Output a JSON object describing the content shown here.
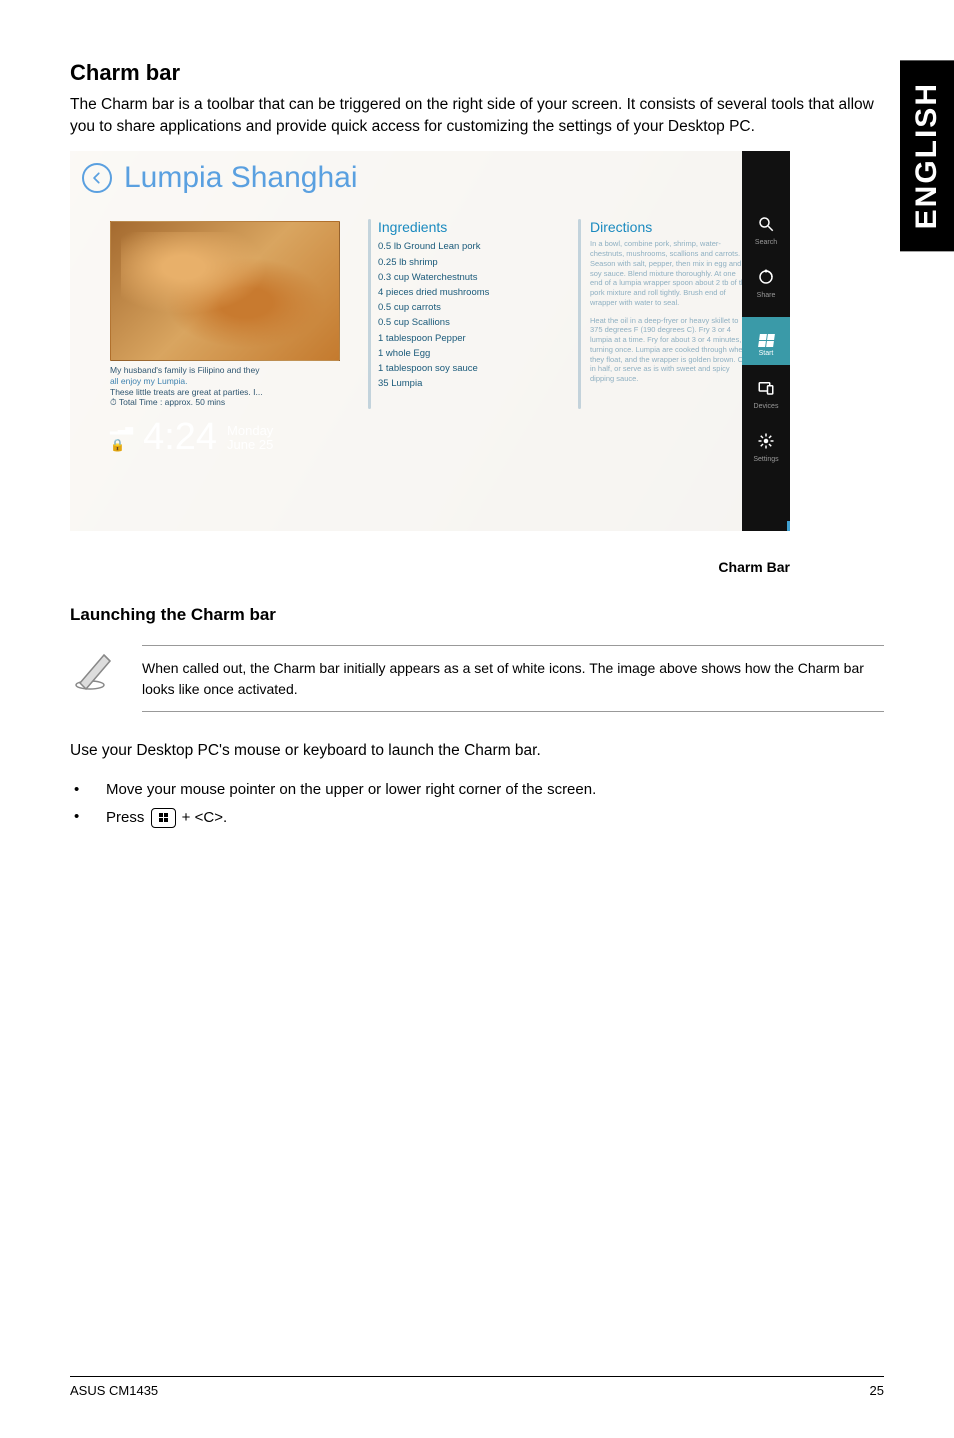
{
  "side_tab": "ENGLISH",
  "section_title": "Charm bar",
  "intro_text": "The Charm bar is a toolbar that can be triggered on the right side of your screen. It consists of several tools that allow you to share applications and provide quick access for customizing the settings of your Desktop PC.",
  "screenshot": {
    "app_title": "Lumpia Shanghai",
    "caption": {
      "line1": "My husband's family is Filipino and they",
      "line2": "all enjoy my Lumpia.",
      "line3": "These little treats are great at parties. I...",
      "line4": "Total Time : approx. 50 mins"
    },
    "time": "4:24",
    "day": "Monday",
    "date": "June 25",
    "ingredients_title": "Ingredients",
    "ingredients": [
      "0.5 lb Ground Lean pork",
      "0.25 lb shrimp",
      "0.3 cup Waterchestnuts",
      "4 pieces dried mushrooms",
      "0.5 cup carrots",
      "0.5 cup Scallions",
      "1 tablespoon Pepper",
      "1 whole Egg",
      "1 tablespoon soy sauce",
      "35 Lumpia"
    ],
    "directions_title": "Directions",
    "directions_p1": "In a bowl, combine pork, shrimp, water-chestnuts, mushrooms, scallions and carrots. Season with salt, pepper, then mix in egg and soy sauce. Blend mixture thoroughly. At one end of a lumpia wrapper spoon about 2 tb of the pork mixture and roll tightly. Brush end of wrapper with water to seal.",
    "directions_p2": "Heat the oil in a deep-fryer or heavy skillet to 375 degrees F (190 degrees C). Fry 3 or 4 lumpia at a time. Fry for about 3 or 4 minutes, turning once. Lumpia are cooked through when they float, and the wrapper is golden brown. Cut in half, or serve as is with sweet and spicy dipping sauce.",
    "charms": [
      {
        "label": "Search"
      },
      {
        "label": "Share"
      },
      {
        "label": "Start"
      },
      {
        "label": "Devices"
      },
      {
        "label": "Settings"
      }
    ]
  },
  "charm_bar_label": "Charm Bar",
  "sub_title": "Launching the Charm bar",
  "note_text": "When called out, the Charm bar initially appears as a set of white icons. The image above shows how the Charm bar looks like once activated.",
  "use_text": "Use your Desktop PC's mouse or keyboard to launch the Charm bar.",
  "bullet1": "Move your mouse pointer on the upper or lower right corner of the screen.",
  "bullet2_prefix": "Press ",
  "bullet2_suffix": " + <C>.",
  "footer_left": "ASUS CM1435",
  "footer_right": "25"
}
